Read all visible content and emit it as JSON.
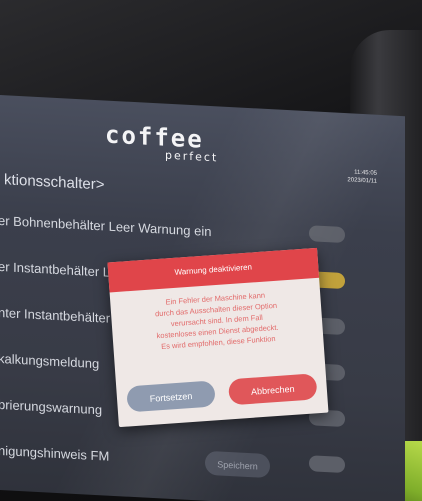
{
  "brand": {
    "logo_main": "coffee",
    "logo_sub": "perfect"
  },
  "clock": {
    "time": "11:45:05",
    "date": "2023/01/11"
  },
  "breadcrumb": "ktionsschalter>",
  "settings": [
    {
      "label": "er Bohnenbehälter Leer Warnung ein",
      "state": "off"
    },
    {
      "label": "er Instantbehälter Leer Warnung ein",
      "state": "on"
    },
    {
      "label": "nter Instantbehälter",
      "state": "off"
    },
    {
      "label": "kalkungsmeldung",
      "state": "off"
    },
    {
      "label": "brierungswarnung",
      "state": "off"
    },
    {
      "label": "nigungshinweis FM",
      "state": "off"
    }
  ],
  "save_label": "Speichern",
  "dialog": {
    "title": "Warnung deaktivieren",
    "message_lines": [
      "Ein Fehler der Maschine kann",
      "durch das Ausschalten dieser Option",
      "verursacht sind. In dem Fall",
      "kostenloses einen Dienst abgedeckt.",
      "Es wird empfohlen, diese Funktion"
    ],
    "continue_label": "Fortsetzen",
    "cancel_label": "Abbrechen"
  },
  "colors": {
    "accent_red": "#e0454a",
    "button_grey": "#8f9bb0",
    "toggle_on": "#c1a13b",
    "machine_green": "#9bc43a"
  }
}
